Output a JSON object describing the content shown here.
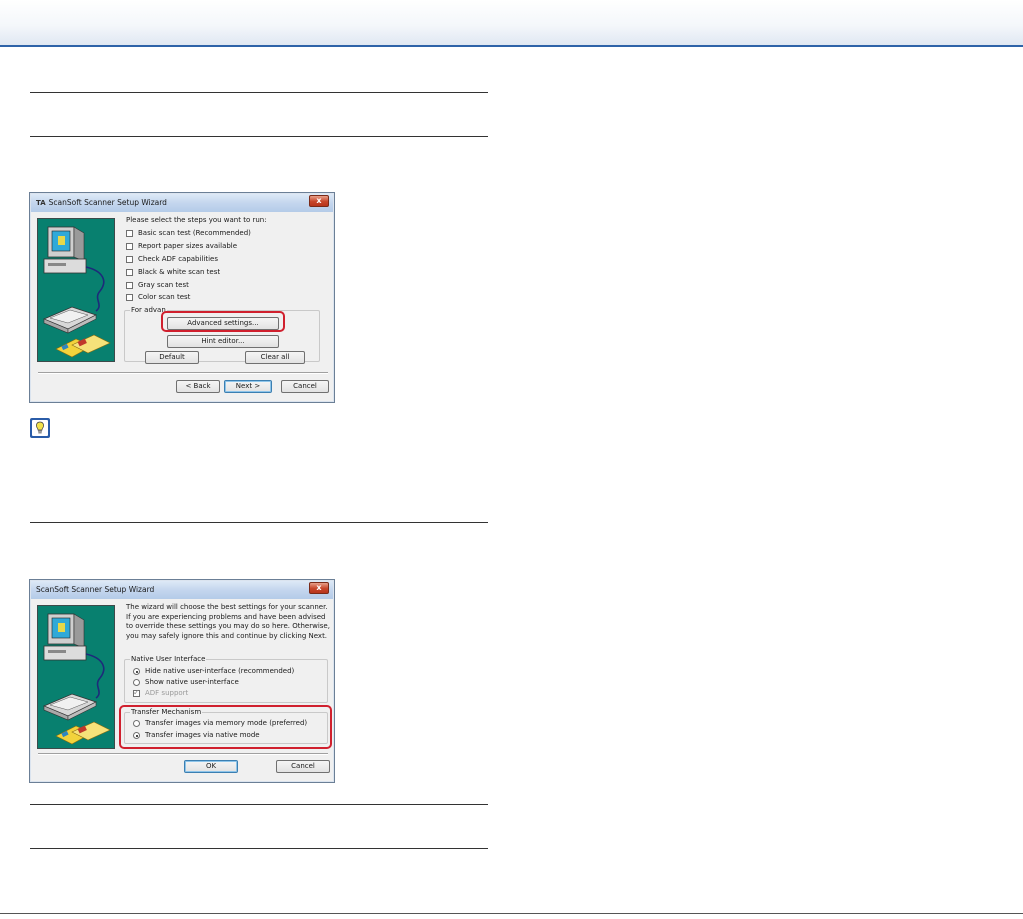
{
  "dialog1": {
    "title": "ScanSoft Scanner Setup Wizard",
    "title_icon": "TA",
    "close_label": "x",
    "prompt": "Please select the steps you want to run:",
    "steps": [
      {
        "label": "Basic scan test (Recommended)",
        "checked": false
      },
      {
        "label": "Report paper sizes available",
        "checked": false
      },
      {
        "label": "Check ADF capabilities",
        "checked": false
      },
      {
        "label": "Black & white scan test",
        "checked": false
      },
      {
        "label": "Gray scan test",
        "checked": false
      },
      {
        "label": "Color scan test",
        "checked": false
      }
    ],
    "advanced_group_label": "For advan",
    "advanced_settings_label": "Advanced settings...",
    "hint_editor_label": "Hint editor...",
    "default_label": "Default",
    "clear_all_label": "Clear all",
    "back_label": "< Back",
    "next_label": "Next >",
    "cancel_label": "Cancel"
  },
  "dialog2": {
    "title": "ScanSoft Scanner Setup Wizard",
    "close_label": "x",
    "description": "The wizard will choose the best settings for your scanner. If you are experiencing problems and have been advised to override these settings you may do so here. Otherwise, you may safely ignore this and continue by clicking Next.",
    "native_ui_group_label": "Native User Interface",
    "native_ui_options": [
      {
        "label": "Hide native user-interface (recommended)",
        "selected": true
      },
      {
        "label": "Show native user-interface",
        "selected": false
      }
    ],
    "adf_support_label": "ADF support",
    "transfer_group_label": "Transfer Mechanism",
    "transfer_options": [
      {
        "label": "Transfer images via memory mode (preferred)",
        "selected": false
      },
      {
        "label": "Transfer images via native mode",
        "selected": true
      }
    ],
    "ok_label": "OK",
    "cancel_label": "Cancel"
  },
  "colors": {
    "header_rule": "#2e63a8",
    "highlight": "#d0202e",
    "art_background": "#08806f",
    "tip_border": "#2a5ca8"
  },
  "icons": [
    "lightbulb-tip-icon",
    "computer-scanner-illustration",
    "close-icon"
  ]
}
